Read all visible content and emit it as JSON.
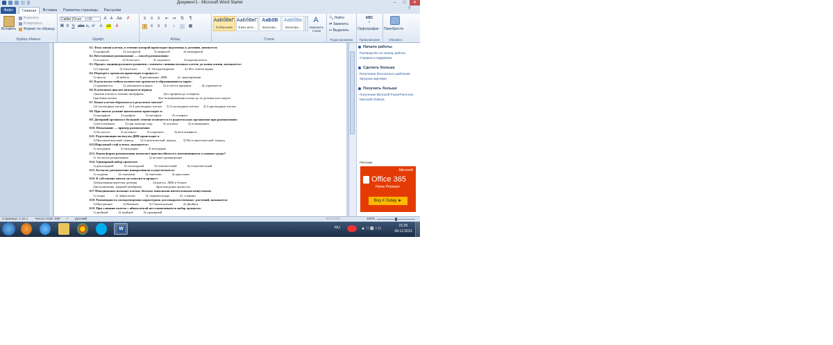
{
  "window": {
    "title": "Документ1 - Microsoft Word Starter"
  },
  "ribbon_tabs": [
    "Файл",
    "Главная",
    "Вставка",
    "Разметка страницы",
    "Рассылки"
  ],
  "clipboard": {
    "paste_label": "Вставить",
    "cut_label": "Вырезать",
    "copy_label": "Копировать",
    "format_painter_label": "Формат по образцу",
    "group_label": "Буфер обмена"
  },
  "font": {
    "font_name": "Calibri (Осно",
    "font_size": "10",
    "group_label": "Шрифт"
  },
  "paragraph": {
    "group_label": "Абзац"
  },
  "styles": {
    "items": [
      {
        "sample": "АаБбВвГг,",
        "name": "¶ Обычный"
      },
      {
        "sample": "АаБбВвГг,",
        "name": "¶ Без инте..."
      },
      {
        "sample": "АаБбВ",
        "name": "Заголово..."
      },
      {
        "sample": "АаБбВв",
        "name": "Заголово..."
      }
    ],
    "change_styles_label": "Изменить стили",
    "group_label": "Стили"
  },
  "editing": {
    "find_label": "Найти",
    "replace_label": "Заменить",
    "select_label": "Выделить",
    "group_label": "Редактирование"
  },
  "proofing": {
    "spelling_label": "Орфография",
    "group_label": "Правописание"
  },
  "update": {
    "label": "Приобрести",
    "group_label": "Обновить"
  },
  "document": {
    "lines": [
      {
        "kind": "q",
        "text": "A1. Фаза жизни клетки, в течение которой происходит подготовка к делению, именуется:"
      },
      {
        "kind": "a",
        "text": "1) профазой                 2) телофазой                 3) анафазой                 4) интерфазой"
      },
      {
        "kind": "q",
        "text": "A2. Вегетативное размножение — способ размножения:"
      },
      {
        "kind": "a",
        "text": "1) полового                 2) бесполого                 3) спорового                 4) партеногенеза"
      },
      {
        "kind": "q",
        "text": "A3. Процесс индивидуального развития с момента слияния половых клеток до конца жизни, называется:"
      },
      {
        "kind": "a",
        "text": "1) Старение             2) Онтогенез             3)  Оплодотворение             4)  Все ответы верны"
      },
      {
        "kind": "q",
        "text": "A4. Перекрёст хромосом происходит в процессе:"
      },
      {
        "kind": "a",
        "text": "1) митоза             2) мейоза             3) репликации  ДНК             4)  транскрипции"
      },
      {
        "kind": "q",
        "text": "A5. В результате мейоза количество хромосом в образовавшихся ядрах:"
      },
      {
        "kind": "a",
        "text": "1) удваивается             2) уменьшается вдвое             3) остается прежним             4) утраивается"
      },
      {
        "kind": "q",
        "text": "A6. Клеточным циклом называется период:"
      },
      {
        "kind": "a",
        "text": "1)жизни клетки в течение интерфазы                         2)от профазы до телофазы"
      },
      {
        "kind": "a",
        "text": "3)деления клетки                                                    4)от возникновения клетки до ее деления или смерти"
      },
      {
        "kind": "q",
        "text": "A7. Какие клетки образуются в результате митоза?"
      },
      {
        "kind": "a",
        "text": "1)2 гаплоидные клетки      2) 4 диплоидные клетки      3) 4 гаплоидные клетки      4) 2 диплоидные клетки"
      },
      {
        "kind": "q",
        "text": "A8. При митозе деление цитоплазмы происходит в:"
      },
      {
        "kind": "a",
        "text": "1) интерфазе             2) профазе             3) метафазе             4) телофазе"
      },
      {
        "kind": "q",
        "text": "A9. Дочерний организм в большой степени отличается от родительских организмов при размножении:"
      },
      {
        "kind": "a",
        "text": "1) вегетативном             2) при помощи спор             3) половом             4) почкованием"
      },
      {
        "kind": "q",
        "text": "A10. Почкование — пример размножения:"
      },
      {
        "kind": "a",
        "text": "1) бесполого             2) полового             3) спорового             4) вегетативного"
      },
      {
        "kind": "q",
        "text": "A11. Редупликация молекулы ДНК происходит в"
      },
      {
        "kind": "a",
        "text": "1) Пресинтетический  период         2) Синтетический  период         3) Постсинтетический  период"
      },
      {
        "kind": "q",
        "text": "A12.Наружный слой клеток, называется:"
      },
      {
        "kind": "a",
        "text": "1) эктодерма             2) энтодерма             3) мезодерма"
      },
      {
        "kind": "q",
        "text": "A13. Какая форма размножения позволяет приспособиться к изменяющимся условиям среды?"
      },
      {
        "kind": "a",
        "text": "1)  бесполое размножение                          2) половое размножение"
      },
      {
        "kind": "q",
        "text": "A14. Одинарный набор хромосом:"
      },
      {
        "kind": "a",
        "text": "1) диплоидный             2) гаплоидный             3) гомозиготный             4) гетерозиготный"
      },
      {
        "kind": "q",
        "text": "A15. Бесполое размножение папоротников осуществляется:"
      },
      {
        "kind": "a",
        "text": "1) спорами             2) семенами             3) гаметами             4) зарослями"
      },
      {
        "kind": "q",
        "text": "A16. К собственно митозу не относится процесс:"
      },
      {
        "kind": "a",
        "text": "1)образования веретена деления                    2)синтеза  ДНК и белков"
      },
      {
        "kind": "a",
        "text": "3)исчезновения  ядерной мембраны                  4)расхождения хромосом"
      },
      {
        "kind": "q",
        "text": "A17 Неподвижные половые клетки, богатые запасными питательными веществами:"
      },
      {
        "kind": "a",
        "text": "1) споры             2)  яйцеклетки             3) сперматозоиды             4)  спермии"
      },
      {
        "kind": "q",
        "text": "A18. Разновидность оплодотворения характерная для покрытосеменных  растений, называется"
      },
      {
        "kind": "a",
        "text": "1) Внутреннее             2) Внешнее             3) Самоопыление             4) Двойное"
      },
      {
        "kind": "q",
        "text": "A19. При слиянии гаметы с яйцеклеткой восстанавливается набор хромосом:"
      },
      {
        "kind": "a",
        "text": "1) двойной             2) тройной             3) одинарный"
      }
    ]
  },
  "side_pane": {
    "section1": {
      "title": "Начало работы",
      "links": [
        "Руководство по началу работы",
        "Справка и поддержка"
      ]
    },
    "section2": {
      "title": "Сделать больше",
      "links": [
        "Получение бесплатных шаблонов",
        "Загрузка картинки"
      ]
    },
    "section3": {
      "title": "Получить больше",
      "links": [
        "Получение Microsoft PowerPoint или",
        "Microsoft Outlook"
      ]
    },
    "ad": {
      "label": "Реклама",
      "brand": "Microsoft",
      "product": "Office 365",
      "edition": "Home Premium",
      "cta": "Buy it Today"
    }
  },
  "status_bar": {
    "page": "Страница: 1 из 1",
    "words": "Число слов: 349",
    "language": "русский",
    "zoom": "100%"
  },
  "taskbar": {
    "lang": "RU",
    "time": "21:25",
    "date": "08.12.2013"
  },
  "colors": {
    "file_tab": "#2a5699",
    "ad_bg": "#e43b05",
    "taskbar": "#1c2c43"
  }
}
